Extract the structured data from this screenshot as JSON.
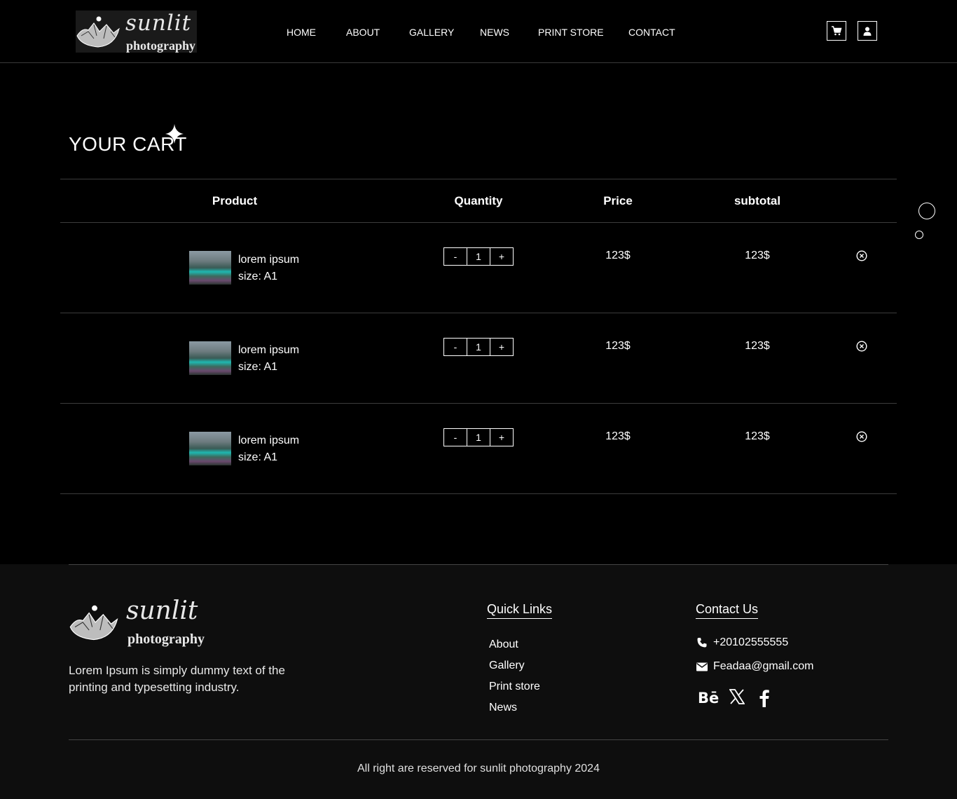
{
  "header": {
    "logo": {
      "line1": "sunlit",
      "line2": "photography"
    },
    "nav": [
      "HOME",
      "ABOUT",
      "GALLERY",
      "NEWS",
      "PRINT STORE",
      "CONTACT"
    ],
    "icons": [
      "cart-icon",
      "user-icon"
    ]
  },
  "cart": {
    "title": "YOUR CART",
    "columns": [
      "Product",
      "Quantity",
      "Price",
      "subtotal"
    ],
    "items": [
      {
        "name": "lorem ipsum",
        "size": "size: A1",
        "quantity": "1",
        "price": "123$",
        "subtotal": "123$"
      },
      {
        "name": "lorem ipsum",
        "size": "size: A1",
        "quantity": "1",
        "price": "123$",
        "subtotal": "123$"
      },
      {
        "name": "lorem ipsum",
        "size": "size: A1",
        "quantity": "1",
        "price": "123$",
        "subtotal": "123$"
      }
    ],
    "qty_minus": "-",
    "qty_plus": "+"
  },
  "footer": {
    "logo": {
      "line1": "sunlit",
      "line2": "photography"
    },
    "about": "Lorem Ipsum is simply dummy text of the printing and typesetting industry.",
    "quick_links": {
      "heading": "Quick Links",
      "links": [
        "About",
        "Gallery",
        "Print store",
        "News"
      ]
    },
    "contact": {
      "heading": "Contact Us",
      "phone": "+20102555555",
      "email": "Feadaa@gmail.com"
    },
    "social": [
      "behance-icon",
      "x-icon",
      "facebook-icon"
    ],
    "copyright": "All right are reserved for sunlit photography 2024"
  }
}
